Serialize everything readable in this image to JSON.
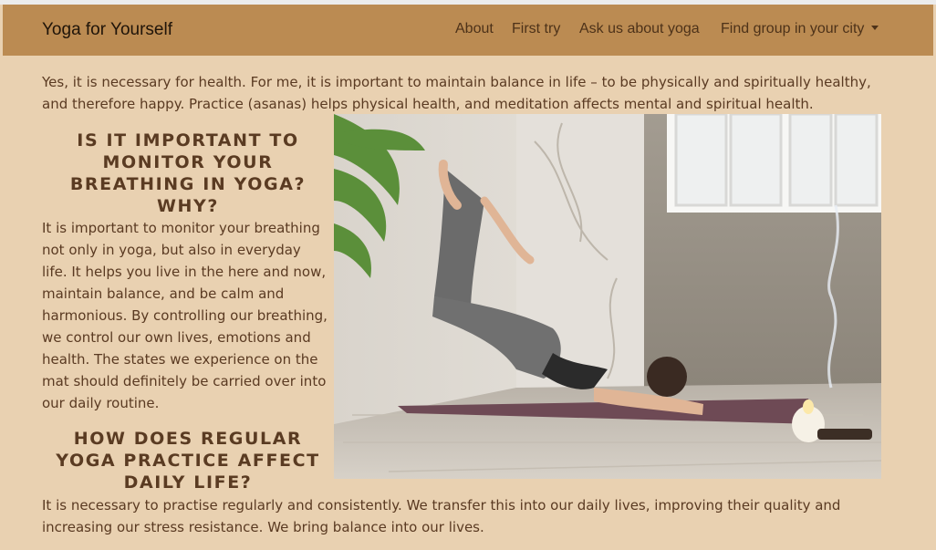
{
  "nav": {
    "brand": "Yoga for Yourself",
    "links": [
      "About",
      "First try",
      "Ask us about yoga",
      "Find group in your city"
    ]
  },
  "intro": "Yes, it is necessary for health. For me, it is important to maintain balance in life – to be physically and spiritually healthy, and therefore happy. Practice (asanas) helps physical health, and meditation affects mental and spiritual health.",
  "section1": {
    "heading": "Is it important to monitor your breathing in yoga? Why?",
    "text": "It is important to monitor your breathing not only in yoga, but also in everyday life. It helps you live in the here and now, maintain balance, and be calm and harmonious. By controlling our breathing, we control our own lives, emotions and health. The states we experience on the mat should definitely be carried over into our daily routine."
  },
  "section2": {
    "heading": "How does regular yoga practice affect daily life?",
    "text": "It is necessary to practise regularly and consistently. We transfer this into our daily lives, improving their quality and increasing our stress resistance. We bring balance into our lives."
  },
  "colors": {
    "page_bg": "#e9d1b1",
    "navbar_bg": "#bb8b52",
    "text": "#5a3a22",
    "brand_text": "#1f1409"
  }
}
